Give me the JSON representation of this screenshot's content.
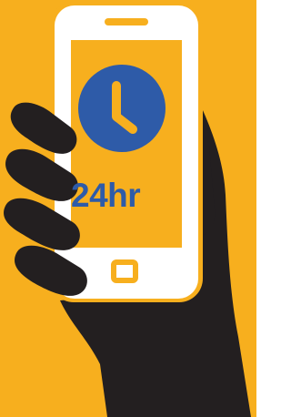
{
  "illustration": {
    "label": "24hr",
    "icons": [
      "hand-icon",
      "smartphone-icon",
      "clock-icon"
    ]
  },
  "colors": {
    "background": "#F7AF1E",
    "hand": "#231F20",
    "phone_body": "#FFFFFF",
    "screen": "#F7AF1E",
    "clock_face": "#2E5BA8",
    "text": "#2E5BA8"
  }
}
